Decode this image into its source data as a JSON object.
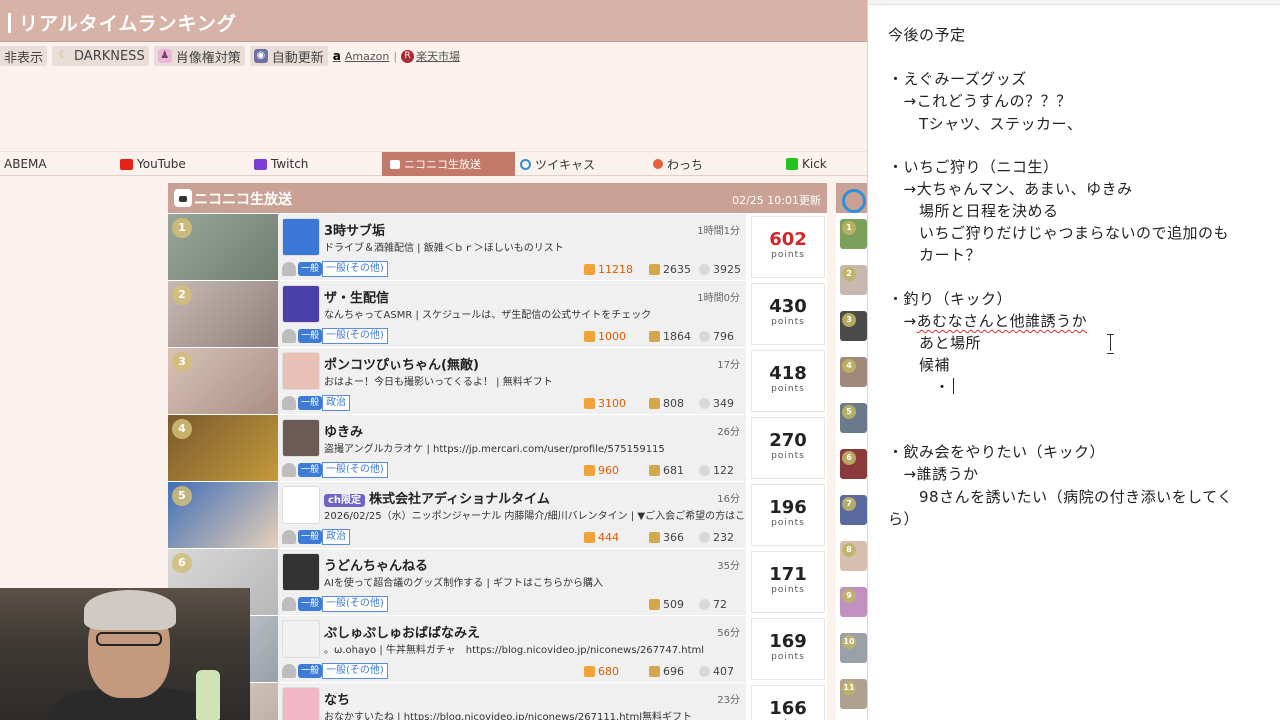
{
  "site": {
    "title": "リアルタイムランキング",
    "toolbar": {
      "hide_label": "非表示",
      "dark_label": "DARKNESS",
      "portrait_label": "肖像権対策",
      "auto_label": "自動更新",
      "amazon_label": "Amazon",
      "rakuten_label": "楽天市場"
    },
    "tabs": [
      {
        "label": "ABEMA",
        "color": ""
      },
      {
        "label": "YouTube",
        "color": "#e62117"
      },
      {
        "label": "Twitch",
        "color": "#7a3ed6"
      },
      {
        "label": "ニコニコ生放送",
        "color": "#ffffff"
      },
      {
        "label": "ツイキャス",
        "color": "#2d8fd8"
      },
      {
        "label": "わっち",
        "color": "#e8603c"
      },
      {
        "label": "Kick",
        "color": "#22c322"
      }
    ],
    "panel": {
      "title": "ニコニコ生放送",
      "updated": "02/25 10:01更新",
      "points_label": "points",
      "rows": [
        {
          "rank": "1",
          "name": "3時サブ垢",
          "desc": "ドライブ＆酒雑配信 | 飯雑＜ｂｒ＞ほしいものリスト",
          "duration": "1時間1分",
          "category": "一般",
          "subcategory": "一般(その他)",
          "gift": "11218",
          "viewers": "2635",
          "comments": "3925",
          "points": "602"
        },
        {
          "rank": "2",
          "name": "ザ・生配信",
          "desc": "なんちゃってASMR | スケジュールは、ザ生配信の公式サイトをチェック",
          "duration": "1時間0分",
          "category": "一般",
          "subcategory": "一般(その他)",
          "gift": "1000",
          "viewers": "1864",
          "comments": "796",
          "points": "430"
        },
        {
          "rank": "3",
          "name": "ポンコツぴぃちゃん(無敵)",
          "desc": "おはよー！今日も撮影いってくるよ！ | 無料ギフト",
          "duration": "17分",
          "category": "一般",
          "subcategory": "政治",
          "gift": "3100",
          "viewers": "808",
          "comments": "349",
          "points": "418"
        },
        {
          "rank": "4",
          "name": "ゆきみ",
          "desc": "盗撮アングルカラオケ | https://jp.mercari.com/user/profile/575159115",
          "duration": "26分",
          "category": "一般",
          "subcategory": "一般(その他)",
          "gift": "960",
          "viewers": "681",
          "comments": "122",
          "points": "270"
        },
        {
          "rank": "5",
          "name": "株式会社アディショナルタイム",
          "badge": "ch限定",
          "desc": "2026/02/25（水）ニッポンジャーナル 内藤陽介/細川バレンタイン | ▼ご入会ご希望の方はこ",
          "duration": "16分",
          "category": "一般",
          "subcategory": "政治",
          "gift": "444",
          "viewers": "366",
          "comments": "232",
          "points": "196"
        },
        {
          "rank": "6",
          "name": "うどんちゃんねる",
          "desc": "AIを使って超合議のグッズ制作する | ギフトはこちらから購入",
          "duration": "35分",
          "category": "一般",
          "subcategory": "一般(その他)",
          "gift": "",
          "viewers": "509",
          "comments": "72",
          "points": "171"
        },
        {
          "rank": "7",
          "name": "ぷしゅぷしゅおばばなみえ",
          "desc": "。ω.ohayo | 牛丼無料ガチャ　https://blog.nicovideo.jp/niconews/267747.html",
          "duration": "56分",
          "category": "一般",
          "subcategory": "一般(その他)",
          "gift": "680",
          "viewers": "696",
          "comments": "407",
          "points": "169"
        },
        {
          "rank": "8",
          "name": "なち",
          "desc": "おなかすいたね | https://blog.nicovideo.jp/niconews/267111.html無料ギフト",
          "duration": "23分",
          "category": "一般",
          "subcategory": "一般(その他)",
          "gift": "",
          "viewers": "",
          "comments": "",
          "points": "166"
        }
      ]
    },
    "side_ranks": [
      "1",
      "2",
      "3",
      "4",
      "5",
      "6",
      "7",
      "8",
      "9",
      "10",
      "11"
    ]
  },
  "notepad": {
    "lines": [
      {
        "text": "今後の予定",
        "top": 0
      },
      {
        "text": "・えぐみーズグッズ"
      },
      {
        "text": "　→これどうすんの？？？"
      },
      {
        "text": "　　Tシャツ、ステッカー、"
      },
      {
        "text": "・いちご狩り（ニコ生）"
      },
      {
        "text": "　→大ちゃんマン、あまい、ゆきみ"
      },
      {
        "text": "　　場所と日程を決める"
      },
      {
        "text": "　　いちご狩りだけじゃつまらないので追加のも"
      },
      {
        "text": "　　カート？"
      },
      {
        "text": "・釣り（キック）"
      },
      {
        "text_prefix": "　→",
        "text_squiggle": "あむなさんと他誰誘うか"
      },
      {
        "text": "　　あと場所"
      },
      {
        "text": "　　候補"
      },
      {
        "text": "　　　・"
      },
      {
        "text": "・飲み会をやりたい（キック）"
      },
      {
        "text": "　→誰誘うか"
      },
      {
        "text": "　　98さんを誘いたい（病院の付き添いをしてく"
      },
      {
        "text": "ら）"
      }
    ]
  }
}
